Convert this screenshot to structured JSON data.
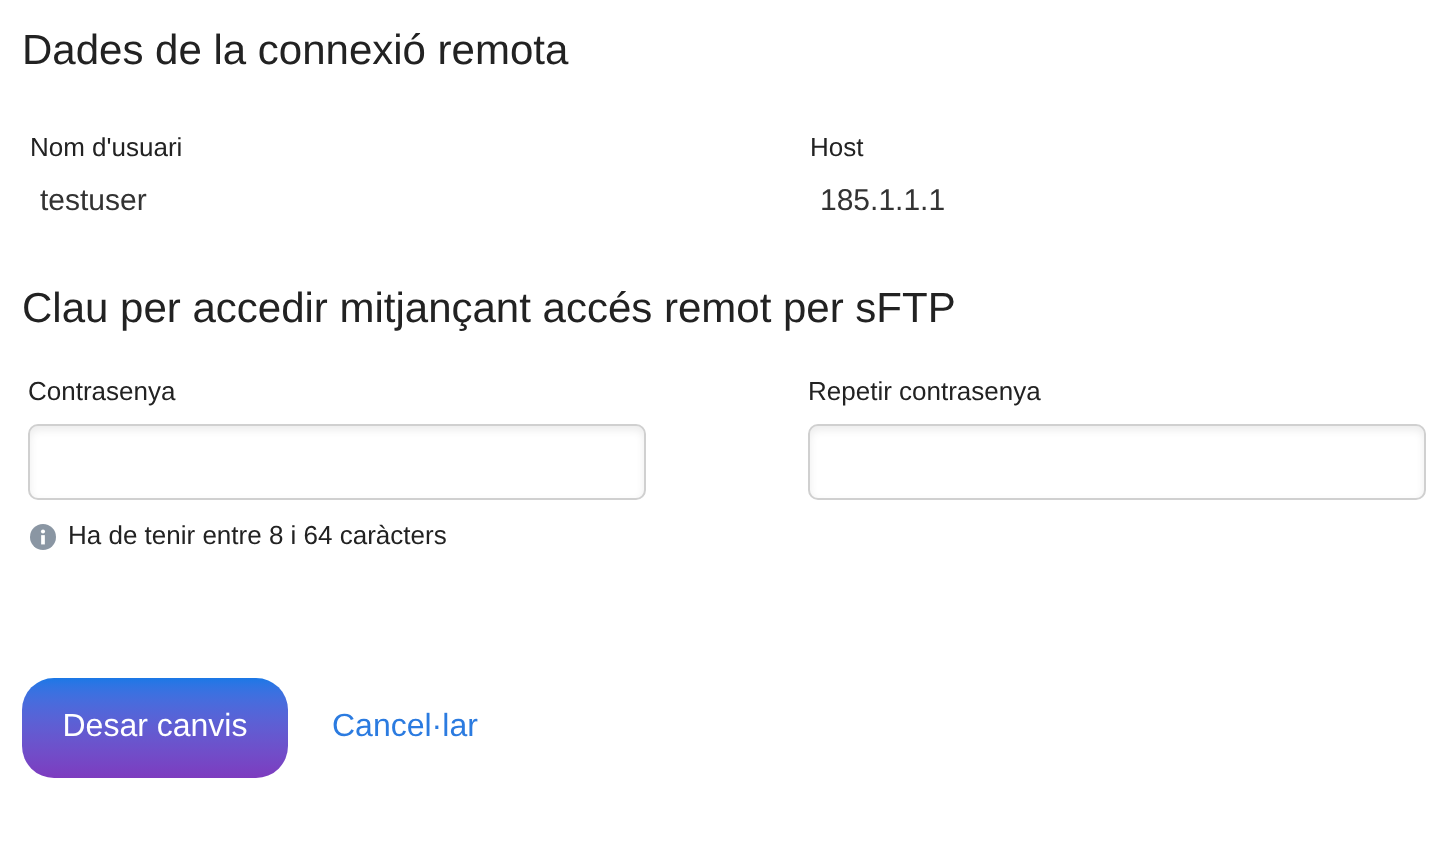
{
  "connection": {
    "title": "Dades de la connexió remota",
    "fields": [
      {
        "label": "Nom d'usuari",
        "value": "testuser"
      },
      {
        "label": "Host",
        "value": "185.1.1.1"
      }
    ]
  },
  "password": {
    "title": "Clau per accedir mitjançant accés remot per sFTP",
    "fields": [
      {
        "label": "Contrasenya"
      },
      {
        "label": "Repetir contrasenya"
      }
    ],
    "hint": "Ha de tenir entre 8 i 64 caràcters"
  },
  "buttons": {
    "save": "Desar canvis",
    "cancel": "Cancel·lar"
  }
}
